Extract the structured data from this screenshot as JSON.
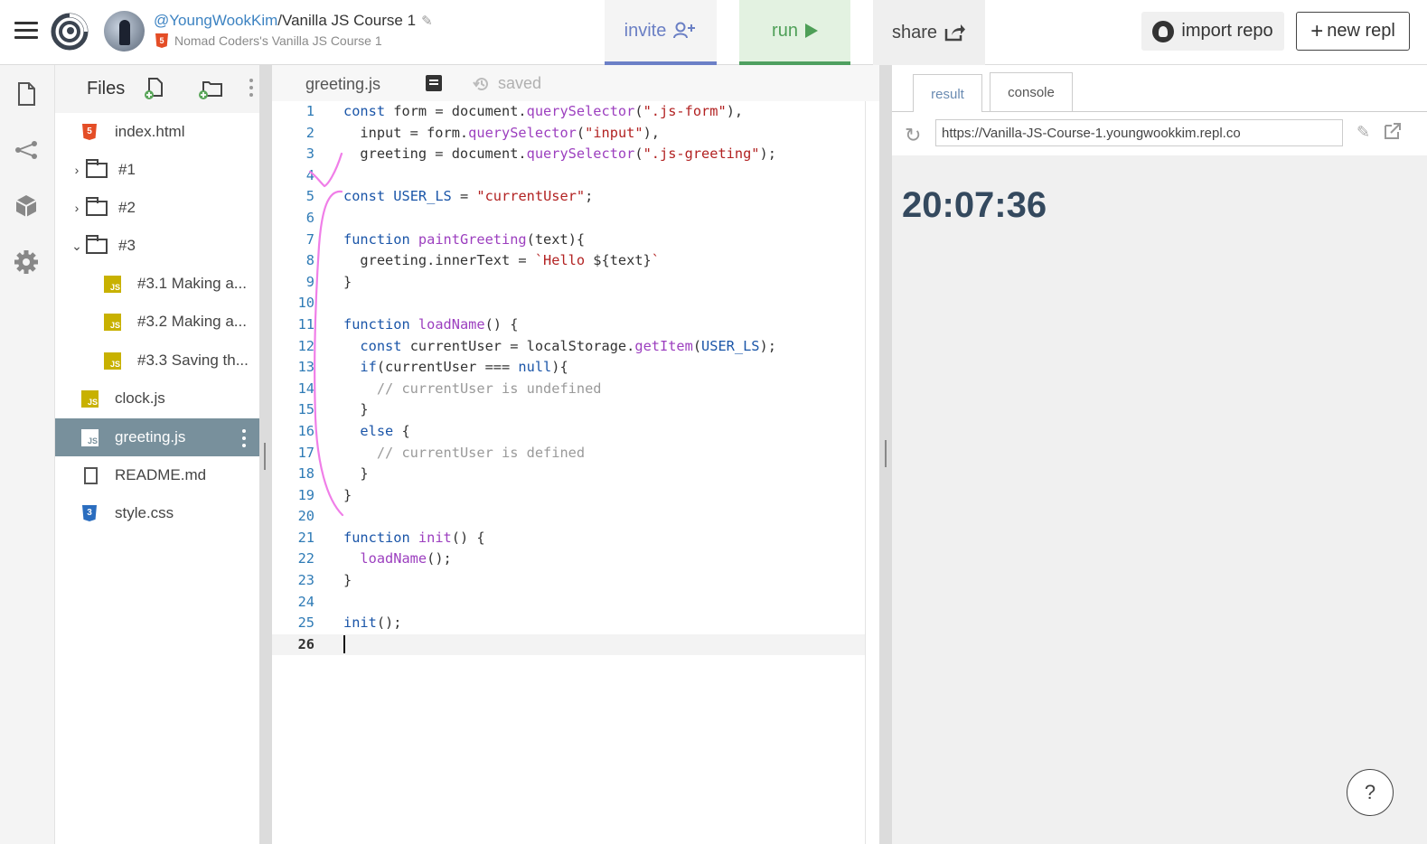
{
  "header": {
    "owner": "@YoungWookKim",
    "separator": "/",
    "repl_name": "Vanilla JS Course 1",
    "subtitle": "Nomad Coders's Vanilla JS Course 1",
    "invite_label": "invite",
    "run_label": "run",
    "share_label": "share",
    "import_label": "import repo",
    "new_label": "new repl"
  },
  "files": {
    "title": "Files",
    "items": [
      {
        "label": "index.html"
      },
      {
        "label": "#1"
      },
      {
        "label": "#2"
      },
      {
        "label": "#3"
      },
      {
        "label": "#3.1 Making a..."
      },
      {
        "label": "#3.2 Making a..."
      },
      {
        "label": "#3.3 Saving th..."
      },
      {
        "label": "clock.js"
      },
      {
        "label": "greeting.js"
      },
      {
        "label": "README.md"
      },
      {
        "label": "style.css"
      }
    ]
  },
  "editor": {
    "tab": "greeting.js",
    "status": "saved",
    "lines": [
      {
        "n": "1"
      },
      {
        "n": "2"
      },
      {
        "n": "3"
      },
      {
        "n": "4"
      },
      {
        "n": "5"
      },
      {
        "n": "6"
      },
      {
        "n": "7"
      },
      {
        "n": "8"
      },
      {
        "n": "9"
      },
      {
        "n": "10"
      },
      {
        "n": "11"
      },
      {
        "n": "12"
      },
      {
        "n": "13"
      },
      {
        "n": "14"
      },
      {
        "n": "15"
      },
      {
        "n": "16"
      },
      {
        "n": "17"
      },
      {
        "n": "18"
      },
      {
        "n": "19"
      },
      {
        "n": "20"
      },
      {
        "n": "21"
      },
      {
        "n": "22"
      },
      {
        "n": "23"
      },
      {
        "n": "24"
      },
      {
        "n": "25"
      },
      {
        "n": "26"
      }
    ],
    "code": {
      "l1_a": "const",
      "l1_b": " form = document.",
      "l1_c": "querySelector",
      "l1_d": "(",
      "l1_e": "\".js-form\"",
      "l1_f": "),",
      "l2_a": "  input = form.",
      "l2_b": "querySelector",
      "l2_c": "(",
      "l2_d": "\"input\"",
      "l2_e": "),",
      "l3_a": "  greeting = document.",
      "l3_b": "querySelector",
      "l3_c": "(",
      "l3_d": "\".js-greeting\"",
      "l3_e": ");",
      "l5_a": "const",
      "l5_b": " ",
      "l5_c": "USER_LS",
      "l5_d": " = ",
      "l5_e": "\"currentUser\"",
      "l5_f": ";",
      "l7_a": "function",
      "l7_b": " ",
      "l7_c": "paintGreeting",
      "l7_d": "(text){",
      "l8_a": "  greeting.innerText = ",
      "l8_b": "`Hello ",
      "l8_c": "${text}",
      "l8_d": "`",
      "l9_a": "}",
      "l11_a": "function",
      "l11_b": " ",
      "l11_c": "loadName",
      "l11_d": "() {",
      "l12_a": "  ",
      "l12_b": "const",
      "l12_c": " currentUser = localStorage.",
      "l12_d": "getItem",
      "l12_e": "(",
      "l12_f": "USER_LS",
      "l12_g": ");",
      "l13_a": "  ",
      "l13_b": "if",
      "l13_c": "(currentUser === ",
      "l13_d": "null",
      "l13_e": "){",
      "l14_a": "    ",
      "l14_b": "// currentUser is undefined",
      "l15_a": "  }",
      "l16_a": "  ",
      "l16_b": "else",
      "l16_c": " {",
      "l17_a": "    ",
      "l17_b": "// currentUser is defined",
      "l18_a": "  }",
      "l19_a": "}",
      "l21_a": "function",
      "l21_b": " ",
      "l21_c": "init",
      "l21_d": "() {",
      "l22_a": "  ",
      "l22_b": "loadName",
      "l22_c": "();",
      "l23_a": "}",
      "l25_a": "init",
      "l25_b": "();"
    }
  },
  "output": {
    "tab_result": "result",
    "tab_console": "console",
    "url": "https://Vanilla-JS-Course-1.youngwookkim.repl.co",
    "clock_text": "20:07:36",
    "help_label": "?"
  },
  "colors": {
    "accent_invite": "#6c80c7",
    "accent_run": "#4fa060",
    "active_file_bg": "#78909c",
    "annotation": "#f07ee8"
  },
  "icons": [
    "hamburger-icon",
    "replit-logo",
    "pencil-icon",
    "user-plus-icon",
    "play-icon",
    "share-icon",
    "github-icon",
    "plus-icon",
    "file-icon",
    "share-nodes-icon",
    "package-icon",
    "gear-icon",
    "new-file-icon",
    "new-folder-icon",
    "html5-icon",
    "folder-icon",
    "js-icon",
    "css3-icon",
    "markdown-icon",
    "format-icon",
    "history-icon",
    "refresh-icon",
    "open-new-tab-icon"
  ]
}
